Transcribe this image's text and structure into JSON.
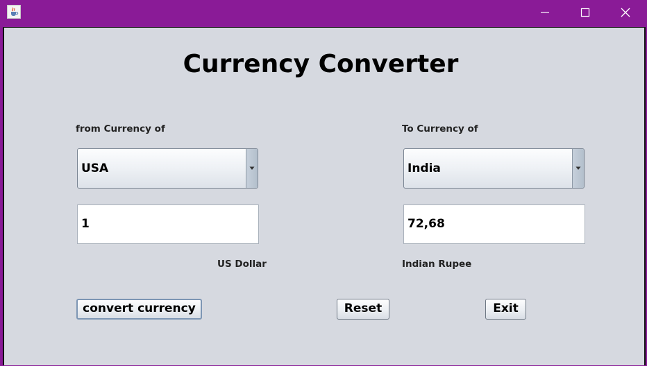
{
  "window": {
    "icon": "java-cup-icon",
    "controls": [
      "minimize-icon",
      "maximize-icon",
      "close-icon"
    ],
    "titlebar_color": "#8a1b97"
  },
  "main": {
    "title": "Currency Converter",
    "from": {
      "label": "from Currency of",
      "selected": "USA",
      "amount": "1",
      "currency_name": "US Dollar"
    },
    "to": {
      "label": "To Currency of",
      "selected": "India",
      "amount": "72,68",
      "currency_name": "Indian Rupee"
    },
    "buttons": {
      "convert": "convert currency",
      "reset": "Reset",
      "exit": "Exit"
    }
  }
}
